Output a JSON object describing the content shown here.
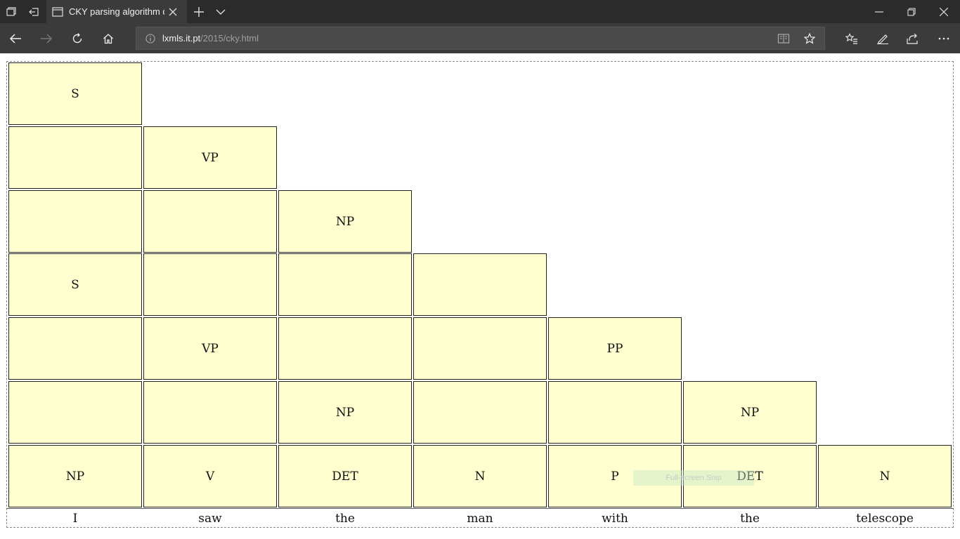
{
  "browser": {
    "tab_title": "CKY parsing algorithm d",
    "address": {
      "domain": "lxmls.it.pt",
      "path": "/2015/cky.html"
    }
  },
  "chart": {
    "rows": [
      [
        "S"
      ],
      [
        "",
        "VP"
      ],
      [
        "",
        "",
        "NP"
      ],
      [
        "S",
        "",
        "",
        ""
      ],
      [
        "",
        "VP",
        "",
        "",
        "PP"
      ],
      [
        "",
        "",
        "NP",
        "",
        "",
        "NP"
      ],
      [
        "NP",
        "V",
        "DET",
        "N",
        "P",
        "DET",
        "N"
      ]
    ],
    "words": [
      "I",
      "saw",
      "the",
      "man",
      "with",
      "the",
      "telescope"
    ]
  },
  "overlay": {
    "snip_label": "Full-screen Snip"
  }
}
